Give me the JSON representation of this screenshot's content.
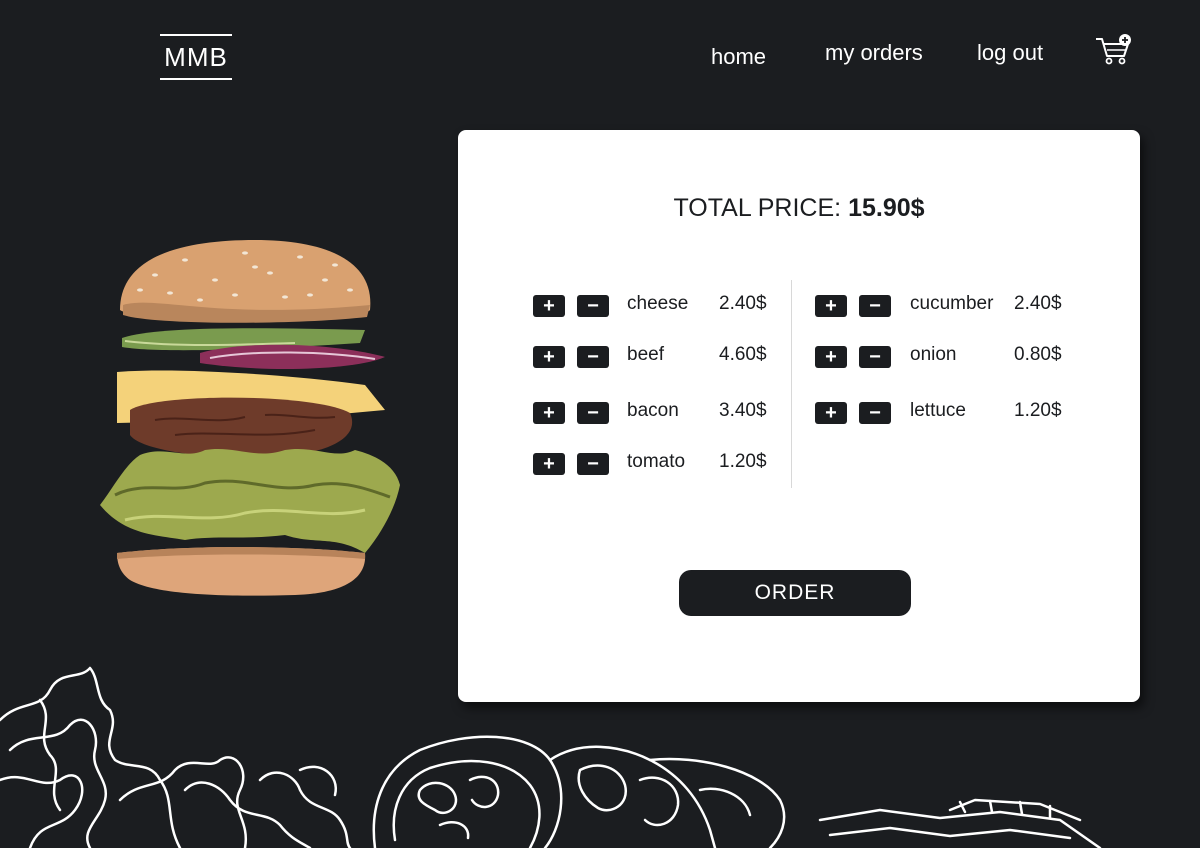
{
  "brand": {
    "logo": "MMB"
  },
  "nav": {
    "home": "home",
    "orders": "my orders",
    "logout": "log out"
  },
  "cart": {
    "icon": "cart-add-icon"
  },
  "summary": {
    "label": "TOTAL PRICE:",
    "value": "15.90$"
  },
  "ingredients_left": [
    {
      "name": "cheese",
      "price": "2.40$"
    },
    {
      "name": "beef",
      "price": "4.60$"
    },
    {
      "name": "bacon",
      "price": "3.40$"
    },
    {
      "name": "tomato",
      "price": "1.20$"
    }
  ],
  "ingredients_right": [
    {
      "name": "cucumber",
      "price": "2.40$"
    },
    {
      "name": "onion",
      "price": "0.80$"
    },
    {
      "name": "lettuce",
      "price": "1.20$"
    }
  ],
  "buttons": {
    "plus": "+",
    "minus": "−",
    "order": "ORDER"
  },
  "colors": {
    "background": "#1b1d20",
    "card": "#ffffff",
    "button": "#1b1d20"
  }
}
